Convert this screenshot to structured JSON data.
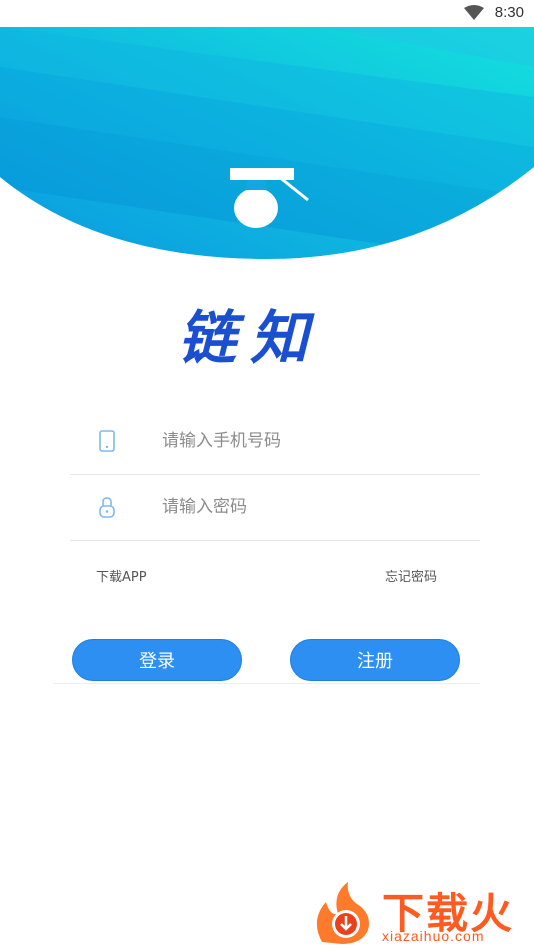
{
  "status_bar": {
    "time": "8:30"
  },
  "brand": {
    "title": "链知"
  },
  "form": {
    "phone_placeholder": "请输入手机号码",
    "password_placeholder": "请输入密码",
    "download_app_label": "下载APP",
    "forgot_password_label": "忘记密码"
  },
  "actions": {
    "login_label": "登录",
    "register_label": "注册"
  },
  "watermark": {
    "text": "下载火",
    "url": "xiazaihuo.com"
  },
  "colors": {
    "accent": "#2d8ff2",
    "brand_text": "#1a4fcf",
    "header_gradient_start": "#0aa6e6",
    "header_gradient_end": "#12d9e0",
    "watermark": "#ff5a1f"
  },
  "icons": [
    "wifi-icon",
    "graduation-cap-icon",
    "phone-icon",
    "lock-icon",
    "download-flame-icon"
  ]
}
